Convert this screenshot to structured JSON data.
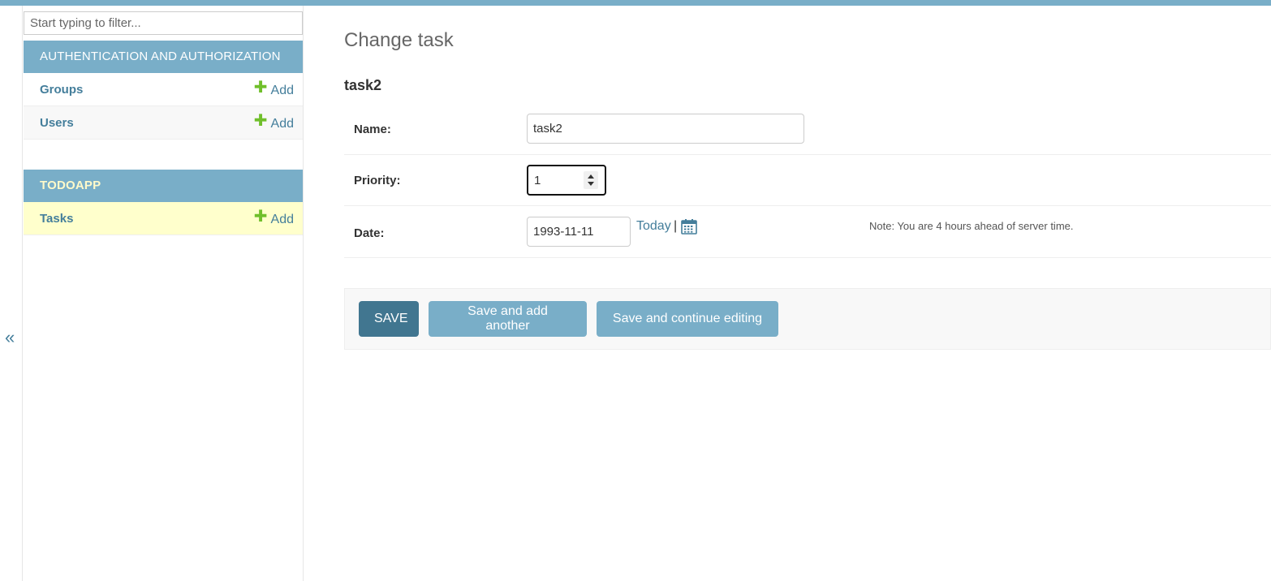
{
  "sidebar": {
    "collapse_glyph": "«",
    "filter_placeholder": "Start typing to filter...",
    "modules": [
      {
        "caption": "AUTHENTICATION AND AUTHORIZATION",
        "models": [
          {
            "name": "Groups",
            "add": "Add"
          },
          {
            "name": "Users",
            "add": "Add"
          }
        ]
      },
      {
        "caption": "TODOAPP",
        "models": [
          {
            "name": "Tasks",
            "add": "Add",
            "current": true
          }
        ]
      }
    ],
    "add_icon": "plus-icon",
    "add_glyph": "✚"
  },
  "content": {
    "title": "Change task",
    "object_name": "task2",
    "fields": {
      "name": {
        "label": "Name:",
        "value": "task2"
      },
      "priority": {
        "label": "Priority:",
        "value": "1"
      },
      "date": {
        "label": "Date:",
        "value": "1993-11-11",
        "today": "Today",
        "separator": "|",
        "calendar_icon": "calendar-icon",
        "note": "Note: You are 4 hours ahead of server time."
      }
    },
    "buttons": {
      "save": "SAVE",
      "save_add_another": "Save and add another",
      "save_continue": "Save and continue editing"
    }
  },
  "colors": {
    "header": "#79aec8",
    "link": "#447e9b",
    "primary_button": "#417690",
    "current_row": "#ffffcc",
    "add_plus": "#70bf2b"
  }
}
